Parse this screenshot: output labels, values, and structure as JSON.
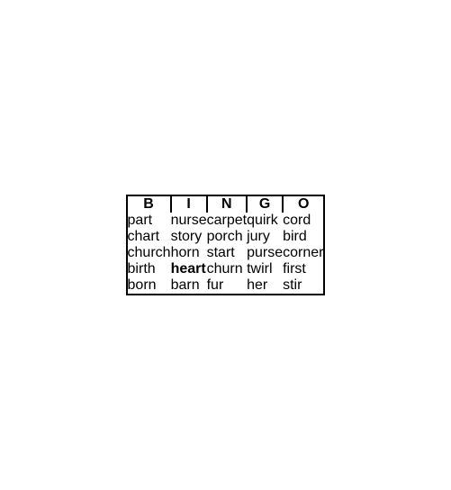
{
  "bingo": {
    "headers": [
      "B",
      "I",
      "N",
      "G",
      "O"
    ],
    "rows": [
      [
        "part",
        "nurse",
        "carpet",
        "quirk",
        "cord"
      ],
      [
        "chart",
        "story",
        "porch",
        "jury",
        "bird"
      ],
      [
        "church",
        "horn",
        "start",
        "purse",
        "corner"
      ],
      [
        "birth",
        "heart",
        "churn",
        "twirl",
        "first"
      ],
      [
        "born",
        "barn",
        "fur",
        "her",
        "stir"
      ]
    ],
    "bold_cells": [
      [
        3,
        1
      ]
    ]
  }
}
